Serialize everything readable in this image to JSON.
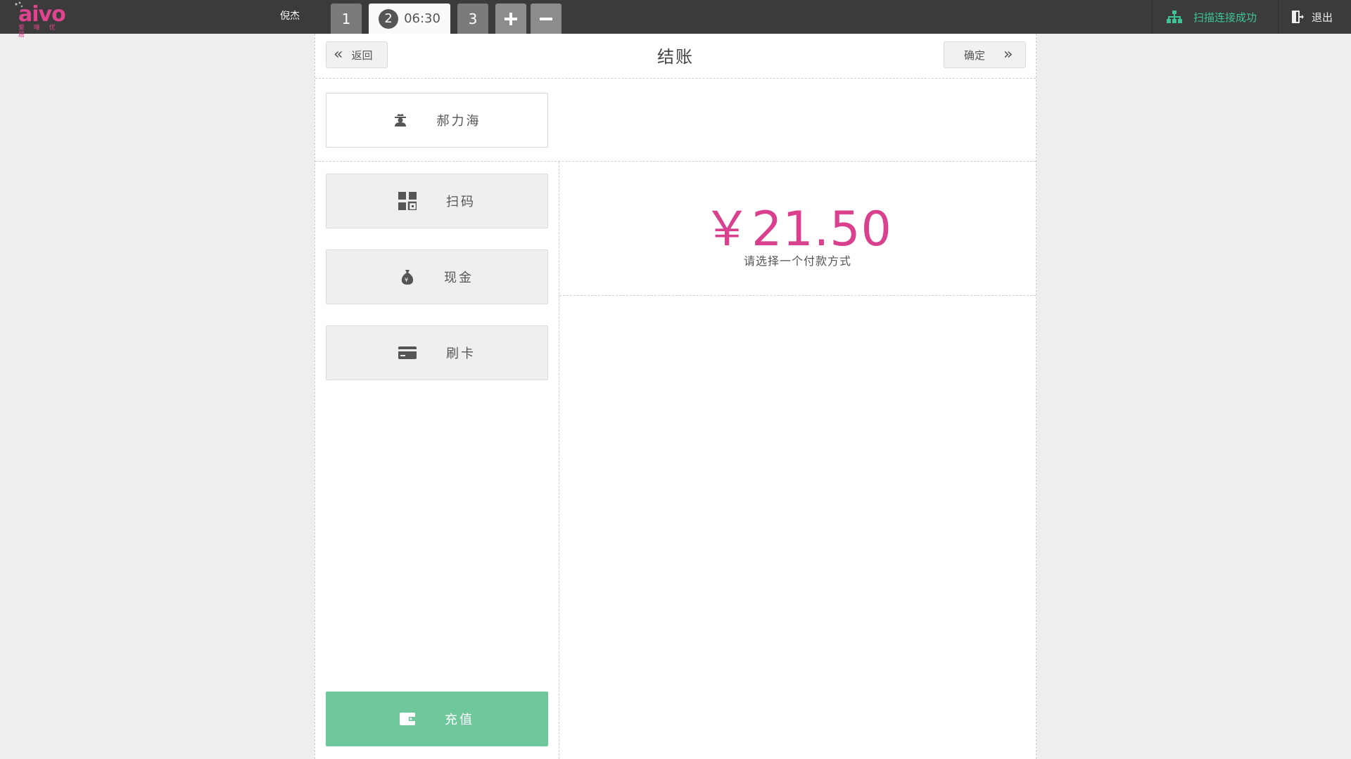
{
  "topbar": {
    "logo_text": "aivo",
    "logo_sub": "爱 唯 优 居",
    "user_name": "倪杰",
    "tabs": [
      {
        "label": "1"
      },
      {
        "label": "2",
        "time": "06:30",
        "active": true
      },
      {
        "label": "3"
      }
    ],
    "add_tab_icon": "plus-icon",
    "remove_tab_icon": "minus-icon",
    "scan_status": "扫描连接成功",
    "logout_label": "退出",
    "accent_color": "#3cc495",
    "brand_color": "#e0448f"
  },
  "checkout": {
    "back_label": "返回",
    "title": "结账",
    "confirm_label": "确定",
    "member_name": "郝力海",
    "payment_methods": [
      {
        "label": "扫码",
        "icon": "qrcode-icon"
      },
      {
        "label": "现金",
        "icon": "money-bag-icon"
      },
      {
        "label": "刷卡",
        "icon": "credit-card-icon"
      }
    ],
    "recharge_label": "充值",
    "recharge_color": "#6fc89c",
    "amount": "￥21.50",
    "amount_color": "#d9408d",
    "hint": "请选择一个付款方式"
  }
}
